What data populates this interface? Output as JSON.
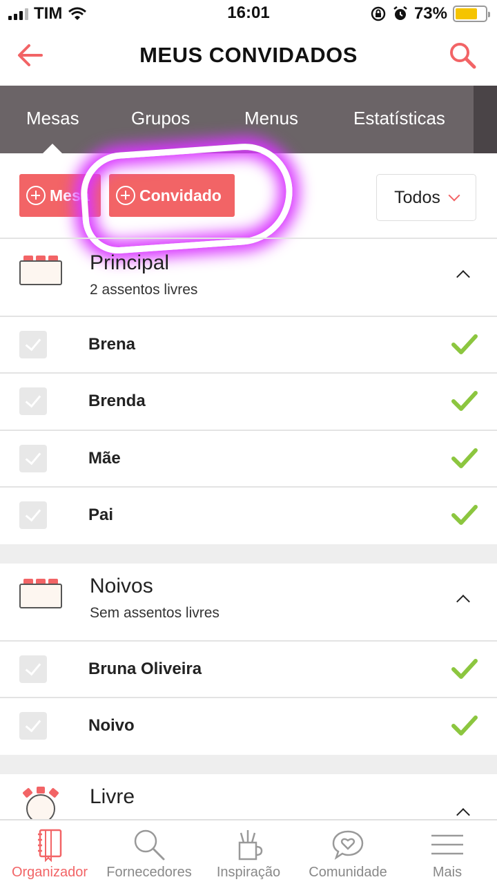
{
  "status_bar": {
    "carrier": "TIM",
    "time": "16:01",
    "battery": "73%",
    "battery_level": 0.73
  },
  "header": {
    "title": "MEUS CONVIDADOS"
  },
  "tabs": [
    {
      "label": "Mesas",
      "active": true
    },
    {
      "label": "Grupos"
    },
    {
      "label": "Menus"
    },
    {
      "label": "Estatísticas"
    }
  ],
  "actions": {
    "add_table": "Mesa",
    "add_guest": "Convidado",
    "filter": "Todos"
  },
  "groups": [
    {
      "title": "Principal",
      "subtitle": "2 assentos livres",
      "guests": [
        {
          "name": "Brena",
          "confirmed": true
        },
        {
          "name": "Brenda",
          "confirmed": true
        },
        {
          "name": "Mãe",
          "confirmed": true
        },
        {
          "name": "Pai",
          "confirmed": true
        }
      ]
    },
    {
      "title": "Noivos",
      "subtitle": "Sem assentos livres",
      "guests": [
        {
          "name": "Bruna Oliveira",
          "confirmed": true
        },
        {
          "name": "Noivo",
          "confirmed": true
        }
      ]
    },
    {
      "title": "Livre"
    }
  ],
  "bottom_nav": [
    {
      "label": "Organizador",
      "active": true,
      "icon": "notebook-icon"
    },
    {
      "label": "Fornecedores",
      "icon": "search-icon"
    },
    {
      "label": "Inspiração",
      "icon": "pencil-cup-icon"
    },
    {
      "label": "Comunidade",
      "icon": "heart-bubble-icon"
    },
    {
      "label": "Mais",
      "icon": "menu-icon"
    }
  ],
  "colors": {
    "accent": "#f26466",
    "tab_bg": "#6b6467",
    "confirmed": "#8cc63f",
    "highlight": "#d936ff"
  }
}
